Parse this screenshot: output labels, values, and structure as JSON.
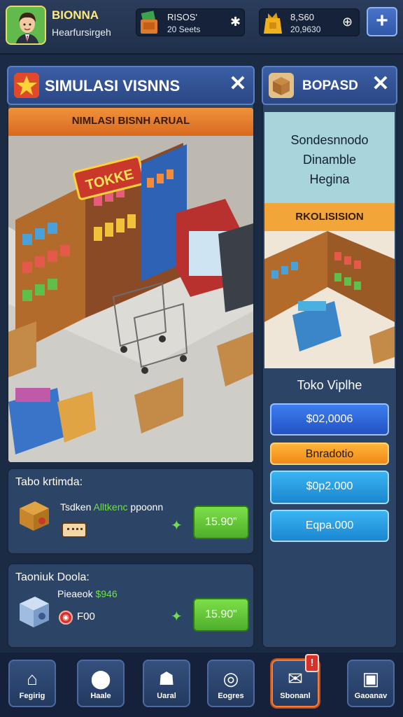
{
  "player": {
    "name": "BIONNA",
    "subtitle": "Hearfursirgeh"
  },
  "resources": [
    {
      "line1": "RISOS'",
      "line2": "20 Seets",
      "action": "✱"
    },
    {
      "line1": "8,S60",
      "line2": "20,9630",
      "action": "⊕"
    }
  ],
  "left_panel": {
    "title": "SIMULASI VISNNS",
    "close": "✕",
    "banner": "NIMLASI BISNH ARUAL",
    "store_sign": "TOKKE"
  },
  "right_panel": {
    "title": "BOPASD",
    "close": "✕",
    "heading_lines": [
      "Sondesnnodo",
      "Dinamble",
      "Hegina"
    ],
    "banner": "RKOLISISION",
    "shop_name": "Toko Viplhe",
    "buttons": [
      "$02,0006",
      "Bnradotio",
      "$0p2.000",
      "Eqpa.000"
    ]
  },
  "card1": {
    "title": "Tabo krtimda:",
    "item": "Tsdken",
    "item_highlight": "Alltkenc",
    "item_suffix": "ppoonn",
    "price": "15.90\""
  },
  "card2": {
    "title": "Taoniuk Doola:",
    "line1": "Pieaeok",
    "line1_value": "$946",
    "line2": "F00",
    "price": "15.90\""
  },
  "nav": [
    {
      "label": "Fegirig",
      "icon": "home-icon"
    },
    {
      "label": "Haale",
      "icon": "map-pin-icon"
    },
    {
      "label": "Uaral",
      "icon": "people-icon"
    },
    {
      "label": "Eogres",
      "icon": "target-icon"
    },
    {
      "label": "Sbonanl",
      "icon": "mail-icon",
      "badge": "!"
    },
    {
      "label": "Gaoanav",
      "icon": "shop-bag-icon"
    }
  ],
  "colors": {
    "background": "#1c2b44",
    "panel": "#2c4466",
    "accent_green": "#5ebc32",
    "accent_orange": "#f0923b",
    "accent_blue": "#2f6be0",
    "accent_cyan": "#2aa7e8"
  }
}
